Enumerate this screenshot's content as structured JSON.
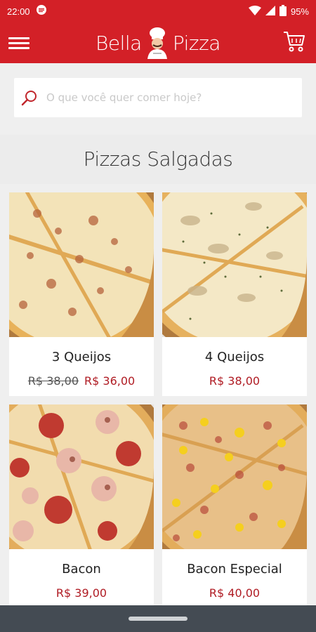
{
  "status_bar": {
    "time": "22:00",
    "battery": "95%"
  },
  "app_bar": {
    "brand_left": "Bella",
    "brand_right": "Pizza",
    "menu_icon": "hamburger-menu-icon",
    "cart_icon": "shopping-cart-icon",
    "accent_color": "#d32027"
  },
  "search": {
    "placeholder": "O que você quer comer hoje?"
  },
  "section": {
    "title": "Pizzas Salgadas"
  },
  "products": [
    {
      "name": "3 Queijos",
      "old_price": "R$ 38,00",
      "price": "R$ 36,00"
    },
    {
      "name": "4 Queijos",
      "old_price": "",
      "price": "R$ 38,00"
    },
    {
      "name": "Bacon",
      "old_price": "",
      "price": "R$ 39,00"
    },
    {
      "name": "Bacon Especial",
      "old_price": "",
      "price": "R$ 40,00"
    }
  ]
}
